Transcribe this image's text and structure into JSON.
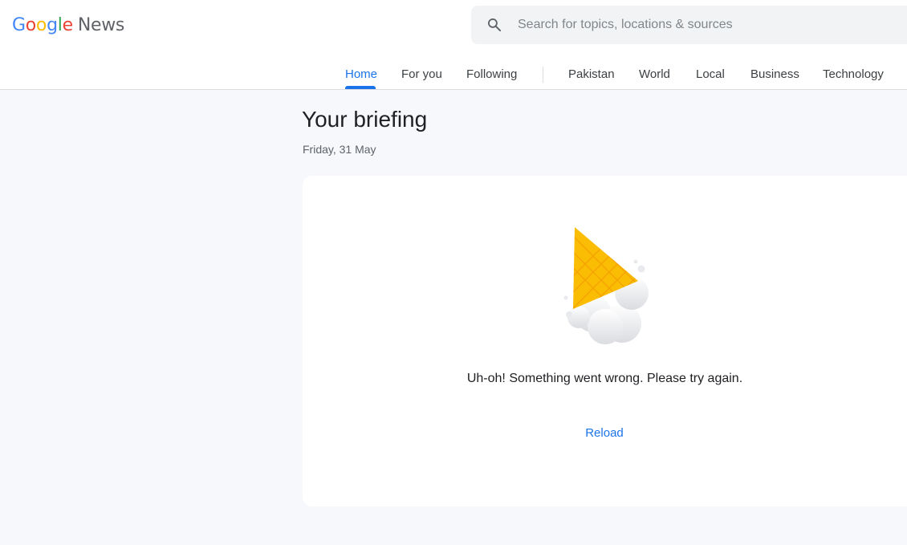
{
  "header": {
    "logo_parts": {
      "G": "G",
      "o1": "o",
      "o2": "o",
      "g": "g",
      "l": "l",
      "e": "e",
      "news": "News"
    },
    "search": {
      "placeholder": "Search for topics, locations & sources",
      "value": "",
      "icon": "search-icon"
    },
    "tabs": [
      {
        "label": "Home",
        "active": true
      },
      {
        "label": "For you",
        "active": false
      },
      {
        "label": "Following",
        "active": false
      },
      {
        "label": "Pakistan",
        "active": false
      },
      {
        "label": "World",
        "active": false
      },
      {
        "label": "Local",
        "active": false
      },
      {
        "label": "Business",
        "active": false
      },
      {
        "label": "Technology",
        "active": false
      }
    ]
  },
  "main": {
    "title": "Your briefing",
    "date": "Friday, 31 May",
    "error": {
      "illustration": "melted-ice-cream-illustration",
      "message": "Uh-oh! Something went wrong. Please try again.",
      "reload_label": "Reload"
    }
  },
  "colors": {
    "accent": "#1a73e8",
    "page_background": "#f6f8fc",
    "card_background": "#ffffff",
    "cone": "#fbbc04"
  }
}
